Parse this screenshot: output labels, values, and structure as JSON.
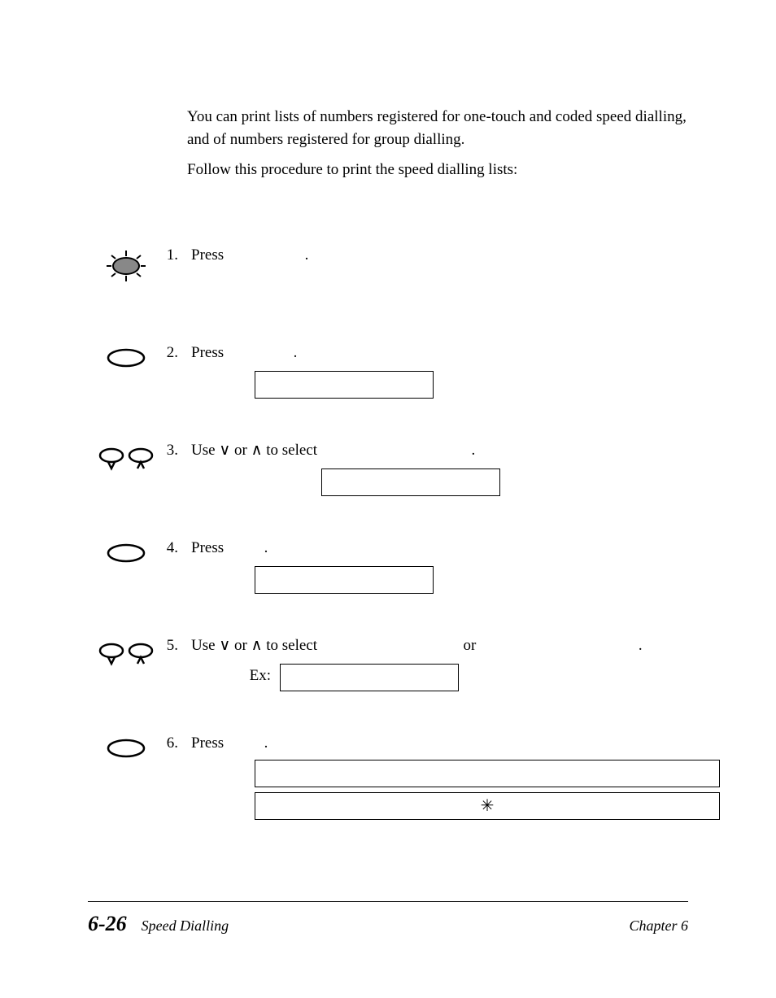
{
  "intro": {
    "p1": "You can print lists of numbers registered for one-touch and coded speed dialling, and of numbers registered for group dialling.",
    "p2": "Follow this procedure to print the speed dialling lists:"
  },
  "steps": {
    "s1": {
      "num": "1.",
      "text": "Press",
      "trail": "."
    },
    "s2": {
      "num": "2.",
      "text": "Press",
      "trail": "."
    },
    "s3": {
      "num": "3.",
      "text_a": "Use ",
      "text_b": " or ",
      "text_c": " to select",
      "trail": "."
    },
    "s4": {
      "num": "4.",
      "text": "Press",
      "trail": "."
    },
    "s5": {
      "num": "5.",
      "text_a": "Use ",
      "text_b": " or ",
      "text_c": " to select",
      "mid": "or",
      "trail": ".",
      "ex": "Ex:"
    },
    "s6": {
      "num": "6.",
      "text": "Press",
      "trail": ".",
      "box2": "✳"
    }
  },
  "footer": {
    "page": "6-26",
    "title": "Speed Dialling",
    "chapter": "Chapter 6"
  },
  "glyphs": {
    "down": "∨",
    "up": "∧"
  }
}
